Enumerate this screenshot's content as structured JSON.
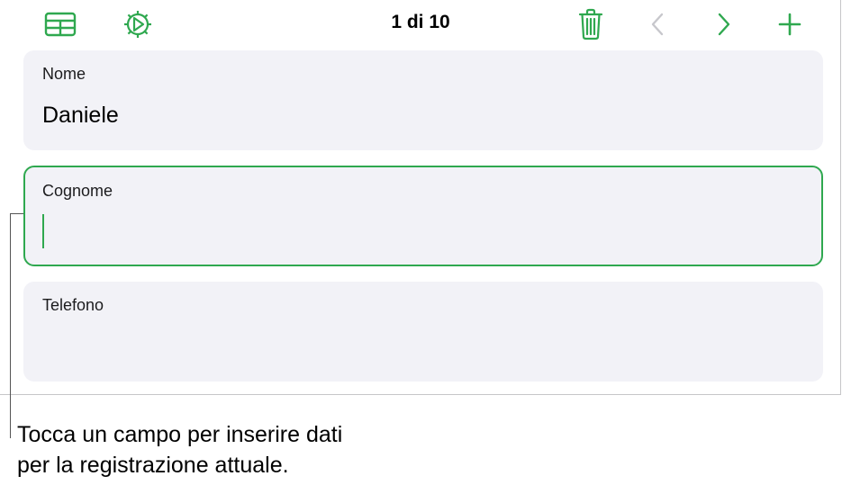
{
  "toolbar": {
    "record_counter": "1 di 10",
    "icons": [
      "table-view-icon",
      "settings-gear-icon",
      "trash-icon",
      "chevron-left-icon",
      "chevron-right-icon",
      "plus-icon"
    ],
    "accent_color": "#2fa84f",
    "disabled_color": "#c7c7cc"
  },
  "fields": [
    {
      "label": "Nome",
      "value": "Daniele"
    },
    {
      "label": "Cognome",
      "value": ""
    },
    {
      "label": "Telefono",
      "value": ""
    }
  ],
  "callout": {
    "line1": "Tocca un campo per inserire dati",
    "line2": "per la registrazione attuale."
  }
}
